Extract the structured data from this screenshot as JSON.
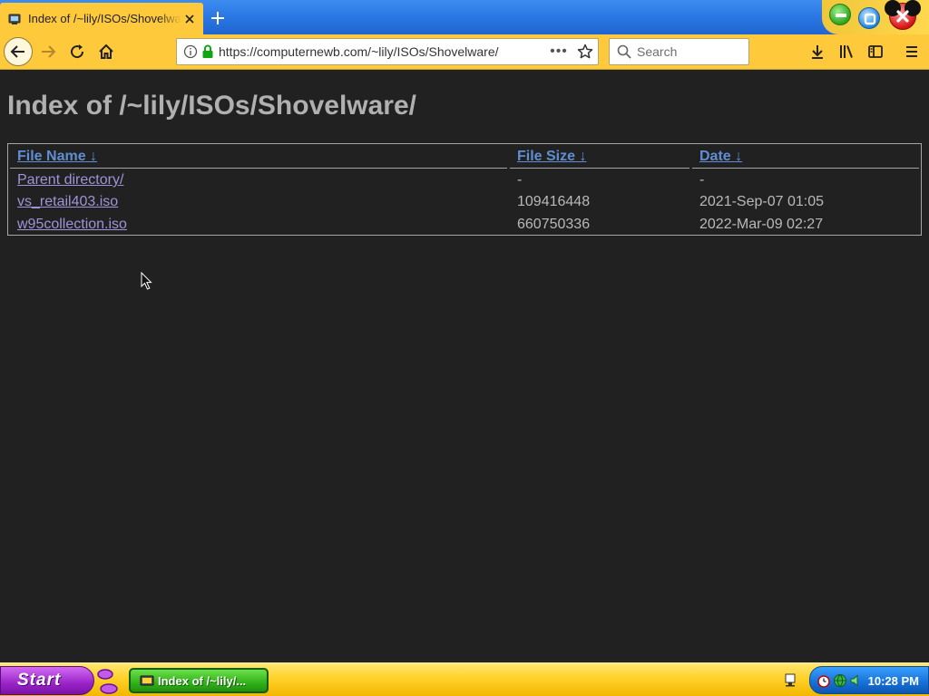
{
  "browser": {
    "tab": {
      "title": "Index of /~lily/ISOs/Shovelware/"
    },
    "url": "https://computernewb.com/~lily/ISOs/Shovelware/",
    "search_placeholder": "Search",
    "url_more_glyph": "•••"
  },
  "page": {
    "title": "Index of /~lily/ISOs/Shovelware/",
    "columns": [
      {
        "label": "File Name",
        "sort": "↓"
      },
      {
        "label": "File Size",
        "sort": "↓"
      },
      {
        "label": "Date",
        "sort": "↓"
      }
    ],
    "rows": [
      {
        "name": "Parent directory/",
        "size": "-",
        "date": "-"
      },
      {
        "name": "vs_retail403.iso",
        "size": "109416448",
        "date": "2021-Sep-07 01:05"
      },
      {
        "name": "w95collection.iso",
        "size": "660750336",
        "date": "2022-Mar-09 02:27"
      }
    ]
  },
  "taskbar": {
    "start_label": "Start",
    "task_label": "Index of /~lily/...",
    "clock": "10:28 PM"
  },
  "colors": {
    "page_background": "#212121",
    "header_link": "#5f8ed4",
    "file_link": "#9e94d8",
    "toolbar": "#ffc93c",
    "tabstrip": "#2b78e4"
  }
}
